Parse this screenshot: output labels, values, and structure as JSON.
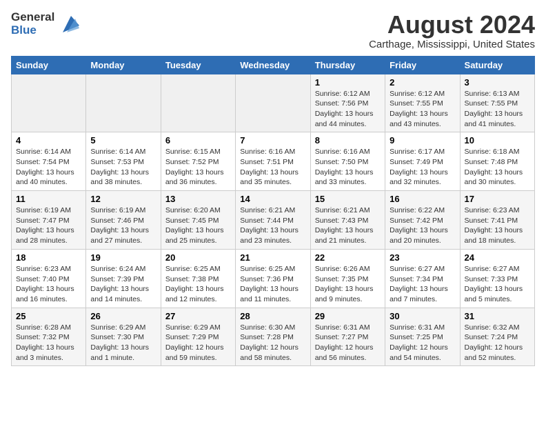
{
  "header": {
    "logo_line1": "General",
    "logo_line2": "Blue",
    "month_year": "August 2024",
    "location": "Carthage, Mississippi, United States"
  },
  "weekdays": [
    "Sunday",
    "Monday",
    "Tuesday",
    "Wednesday",
    "Thursday",
    "Friday",
    "Saturday"
  ],
  "weeks": [
    [
      {
        "num": "",
        "empty": true
      },
      {
        "num": "",
        "empty": true
      },
      {
        "num": "",
        "empty": true
      },
      {
        "num": "",
        "empty": true
      },
      {
        "num": "1",
        "sunrise": "6:12 AM",
        "sunset": "7:56 PM",
        "daylight": "13 hours and 44 minutes."
      },
      {
        "num": "2",
        "sunrise": "6:12 AM",
        "sunset": "7:55 PM",
        "daylight": "13 hours and 43 minutes."
      },
      {
        "num": "3",
        "sunrise": "6:13 AM",
        "sunset": "7:55 PM",
        "daylight": "13 hours and 41 minutes."
      }
    ],
    [
      {
        "num": "4",
        "sunrise": "6:14 AM",
        "sunset": "7:54 PM",
        "daylight": "13 hours and 40 minutes."
      },
      {
        "num": "5",
        "sunrise": "6:14 AM",
        "sunset": "7:53 PM",
        "daylight": "13 hours and 38 minutes."
      },
      {
        "num": "6",
        "sunrise": "6:15 AM",
        "sunset": "7:52 PM",
        "daylight": "13 hours and 36 minutes."
      },
      {
        "num": "7",
        "sunrise": "6:16 AM",
        "sunset": "7:51 PM",
        "daylight": "13 hours and 35 minutes."
      },
      {
        "num": "8",
        "sunrise": "6:16 AM",
        "sunset": "7:50 PM",
        "daylight": "13 hours and 33 minutes."
      },
      {
        "num": "9",
        "sunrise": "6:17 AM",
        "sunset": "7:49 PM",
        "daylight": "13 hours and 32 minutes."
      },
      {
        "num": "10",
        "sunrise": "6:18 AM",
        "sunset": "7:48 PM",
        "daylight": "13 hours and 30 minutes."
      }
    ],
    [
      {
        "num": "11",
        "sunrise": "6:19 AM",
        "sunset": "7:47 PM",
        "daylight": "13 hours and 28 minutes."
      },
      {
        "num": "12",
        "sunrise": "6:19 AM",
        "sunset": "7:46 PM",
        "daylight": "13 hours and 27 minutes."
      },
      {
        "num": "13",
        "sunrise": "6:20 AM",
        "sunset": "7:45 PM",
        "daylight": "13 hours and 25 minutes."
      },
      {
        "num": "14",
        "sunrise": "6:21 AM",
        "sunset": "7:44 PM",
        "daylight": "13 hours and 23 minutes."
      },
      {
        "num": "15",
        "sunrise": "6:21 AM",
        "sunset": "7:43 PM",
        "daylight": "13 hours and 21 minutes."
      },
      {
        "num": "16",
        "sunrise": "6:22 AM",
        "sunset": "7:42 PM",
        "daylight": "13 hours and 20 minutes."
      },
      {
        "num": "17",
        "sunrise": "6:23 AM",
        "sunset": "7:41 PM",
        "daylight": "13 hours and 18 minutes."
      }
    ],
    [
      {
        "num": "18",
        "sunrise": "6:23 AM",
        "sunset": "7:40 PM",
        "daylight": "13 hours and 16 minutes."
      },
      {
        "num": "19",
        "sunrise": "6:24 AM",
        "sunset": "7:39 PM",
        "daylight": "13 hours and 14 minutes."
      },
      {
        "num": "20",
        "sunrise": "6:25 AM",
        "sunset": "7:38 PM",
        "daylight": "13 hours and 12 minutes."
      },
      {
        "num": "21",
        "sunrise": "6:25 AM",
        "sunset": "7:36 PM",
        "daylight": "13 hours and 11 minutes."
      },
      {
        "num": "22",
        "sunrise": "6:26 AM",
        "sunset": "7:35 PM",
        "daylight": "13 hours and 9 minutes."
      },
      {
        "num": "23",
        "sunrise": "6:27 AM",
        "sunset": "7:34 PM",
        "daylight": "13 hours and 7 minutes."
      },
      {
        "num": "24",
        "sunrise": "6:27 AM",
        "sunset": "7:33 PM",
        "daylight": "13 hours and 5 minutes."
      }
    ],
    [
      {
        "num": "25",
        "sunrise": "6:28 AM",
        "sunset": "7:32 PM",
        "daylight": "13 hours and 3 minutes."
      },
      {
        "num": "26",
        "sunrise": "6:29 AM",
        "sunset": "7:30 PM",
        "daylight": "13 hours and 1 minute."
      },
      {
        "num": "27",
        "sunrise": "6:29 AM",
        "sunset": "7:29 PM",
        "daylight": "12 hours and 59 minutes."
      },
      {
        "num": "28",
        "sunrise": "6:30 AM",
        "sunset": "7:28 PM",
        "daylight": "12 hours and 58 minutes."
      },
      {
        "num": "29",
        "sunrise": "6:31 AM",
        "sunset": "7:27 PM",
        "daylight": "12 hours and 56 minutes."
      },
      {
        "num": "30",
        "sunrise": "6:31 AM",
        "sunset": "7:25 PM",
        "daylight": "12 hours and 54 minutes."
      },
      {
        "num": "31",
        "sunrise": "6:32 AM",
        "sunset": "7:24 PM",
        "daylight": "12 hours and 52 minutes."
      }
    ]
  ]
}
